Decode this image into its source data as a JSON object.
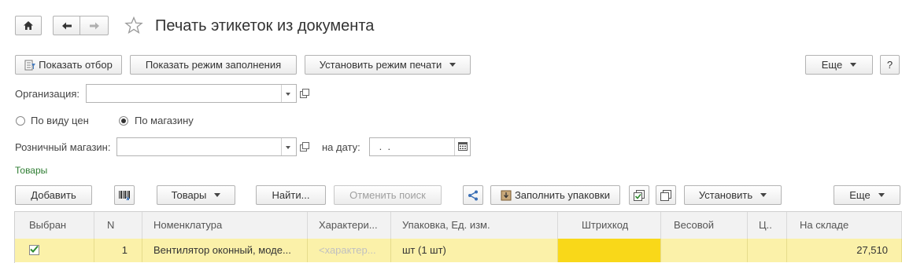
{
  "window": {
    "title": "Печать этикеток из документа"
  },
  "toolbar": {
    "show_filter": "Показать отбор",
    "show_fill_mode": "Показать режим заполнения",
    "set_print_mode": "Установить режим печати",
    "more": "Еще",
    "help": "?"
  },
  "form": {
    "organization_label": "Организация:",
    "organization_value": "",
    "radio_by_price_type": "По виду цен",
    "radio_by_store": "По магазину",
    "selected_radio": "По магазину",
    "retail_store_label": "Розничный магазин:",
    "retail_store_value": "",
    "date_label": "на дату:",
    "date_value": " .  ."
  },
  "goods": {
    "section_title": "Товары",
    "add": "Добавить",
    "goods_menu": "Товары",
    "find": "Найти...",
    "cancel_search": "Отменить поиск",
    "fill_packages": "Заполнить упаковки",
    "set": "Установить",
    "more": "Еще"
  },
  "table": {
    "columns": [
      "Выбран",
      "N",
      "Номенклатура",
      "Характери...",
      "Упаковка, Ед. изм.",
      "Штрихкод",
      "Весовой",
      "Ц..",
      "На складе"
    ],
    "rows": [
      {
        "selected": true,
        "n": "1",
        "nomenclature": "Вентилятор оконный, моде...",
        "characteristic": "<характер...",
        "package": "шт (1 шт)",
        "barcode": "",
        "weighted": "",
        "price": "",
        "stock": "27,510"
      }
    ]
  },
  "colors": {
    "accent_green": "#2e7d32",
    "row_highlight": "#fbf1a9",
    "barcode_cell": "#f9d819"
  }
}
